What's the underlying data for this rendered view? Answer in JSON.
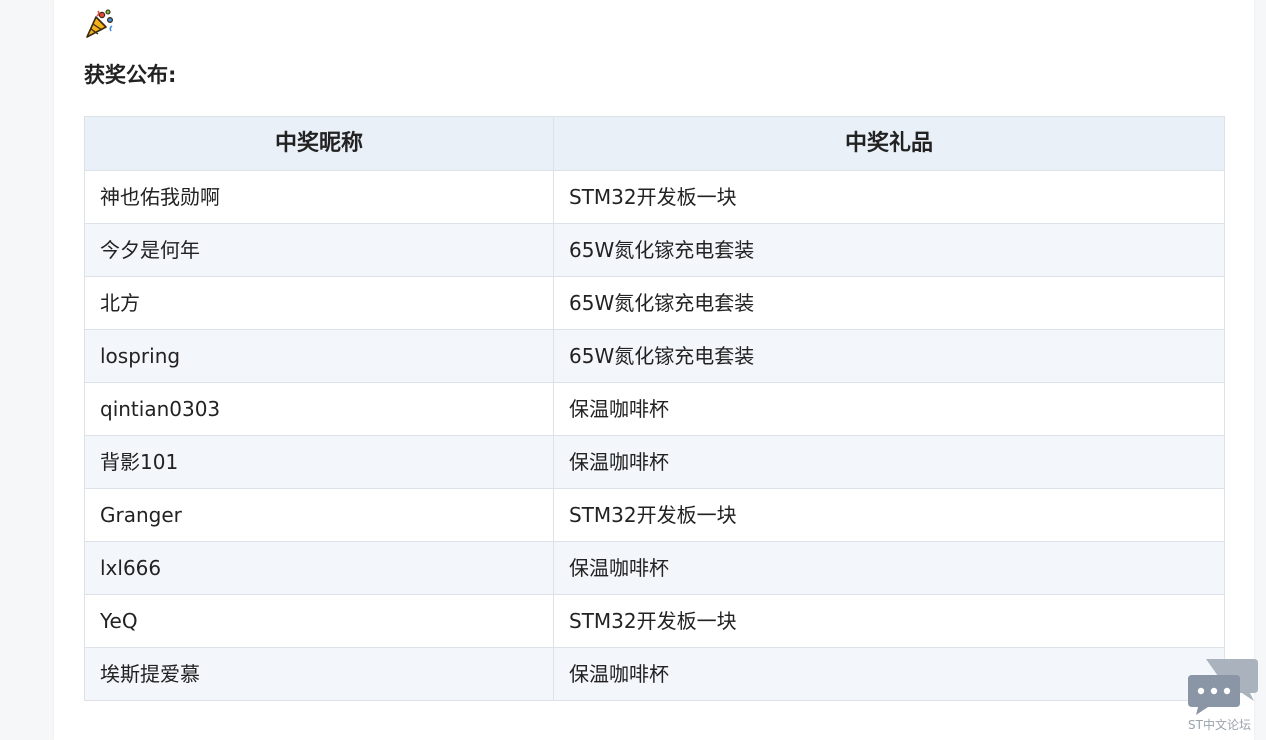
{
  "announcement": {
    "icon": "party-popper-icon",
    "title": "获奖公布:"
  },
  "table": {
    "headers": [
      "中奖昵称",
      "中奖礼品"
    ],
    "rows": [
      [
        "神也佑我勋啊",
        "STM32开发板一块"
      ],
      [
        "今夕是何年",
        "65W氮化镓充电套装"
      ],
      [
        "北方",
        "65W氮化镓充电套装"
      ],
      [
        "lospring",
        "65W氮化镓充电套装"
      ],
      [
        "qintian0303",
        "保温咖啡杯"
      ],
      [
        "背影101",
        "保温咖啡杯"
      ],
      [
        "Granger",
        "STM32开发板一块"
      ],
      [
        "lxl666",
        "保温咖啡杯"
      ],
      [
        "YeQ",
        "STM32开发板一块"
      ],
      [
        "埃斯提爱慕",
        "保温咖啡杯"
      ]
    ]
  },
  "forum_widget": {
    "icon": "chat-bubbles-icon",
    "label": "ST中文论坛"
  },
  "colors": {
    "header_bg": "#eaf0f8",
    "stripe_bg": "#f3f6fb",
    "border": "#dde2e8",
    "widget": "#8a96a5"
  }
}
